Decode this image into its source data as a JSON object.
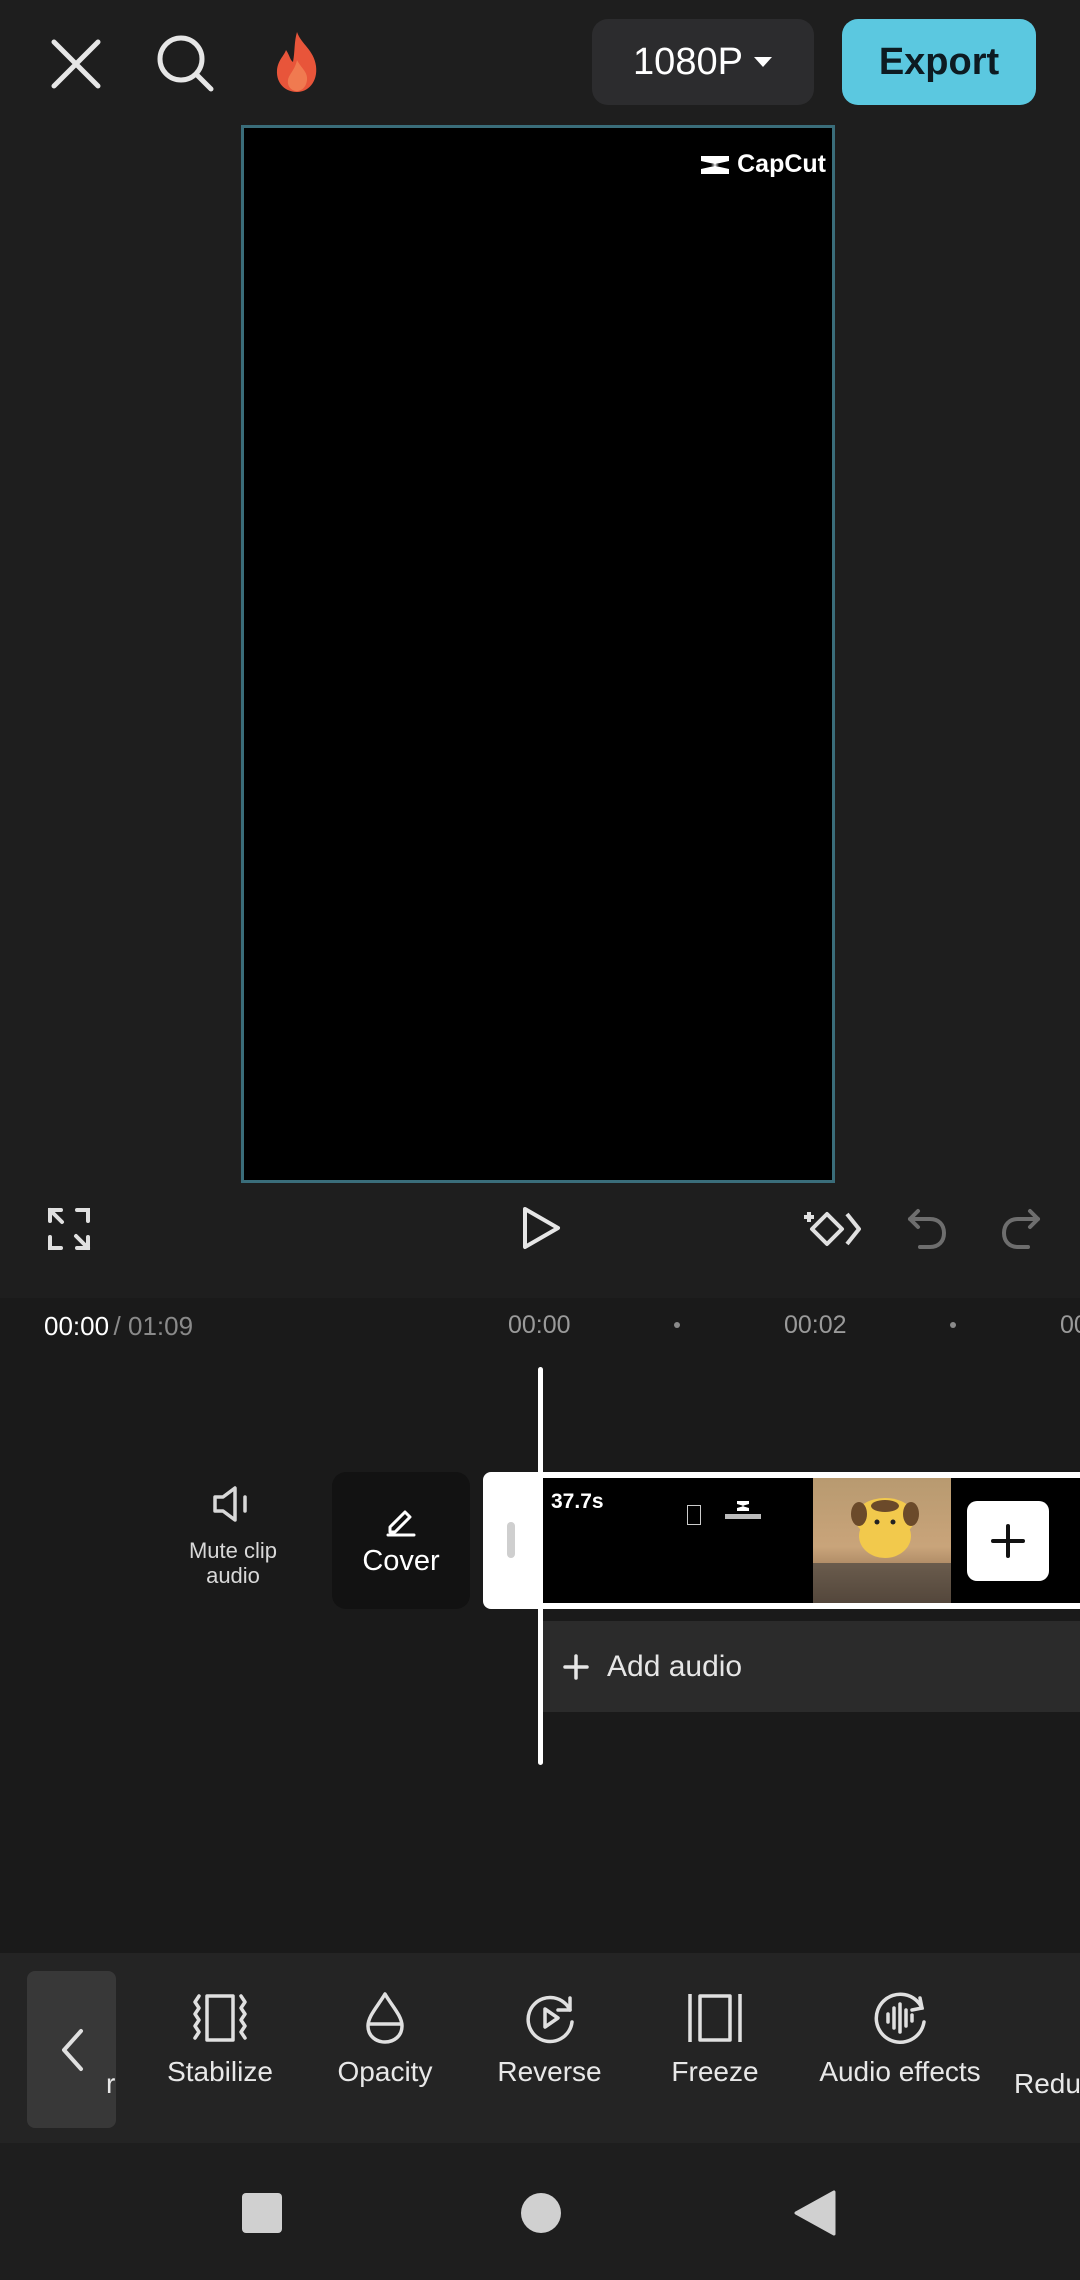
{
  "top_bar": {
    "close_icon": "close-icon",
    "search_icon": "search-icon",
    "trending_icon": "fire-icon",
    "resolution_label": "1080P",
    "export_label": "Export"
  },
  "preview": {
    "watermark_text": "CapCut"
  },
  "controls": {
    "fullscreen_icon": "fullscreen-icon",
    "play_icon": "play-icon",
    "keyframe_icon": "keyframe-add-icon",
    "undo_icon": "undo-icon",
    "redo_icon": "redo-icon"
  },
  "timeline": {
    "current_time": "00:00",
    "total_time": "/ 01:09",
    "ruler_labels": [
      "00:00",
      "00:02",
      "00"
    ],
    "mute_label": "Mute clip audio",
    "cover_label": "Cover",
    "clip_duration": "37.7s",
    "add_audio_label": "Add audio"
  },
  "toolbar": {
    "partial_label": "r",
    "items": [
      {
        "label": "Stabilize",
        "icon": "stabilize-icon"
      },
      {
        "label": "Opacity",
        "icon": "opacity-icon"
      },
      {
        "label": "Reverse",
        "icon": "reverse-icon"
      },
      {
        "label": "Freeze",
        "icon": "freeze-icon"
      },
      {
        "label": "Audio effects",
        "icon": "audio-effects-icon"
      },
      {
        "label": "Redu",
        "icon": "reduce-noise-icon"
      }
    ]
  },
  "colors": {
    "accent": "#5bc8e0",
    "preview_border": "#3a6d7a",
    "background": "#1e1e1e"
  }
}
